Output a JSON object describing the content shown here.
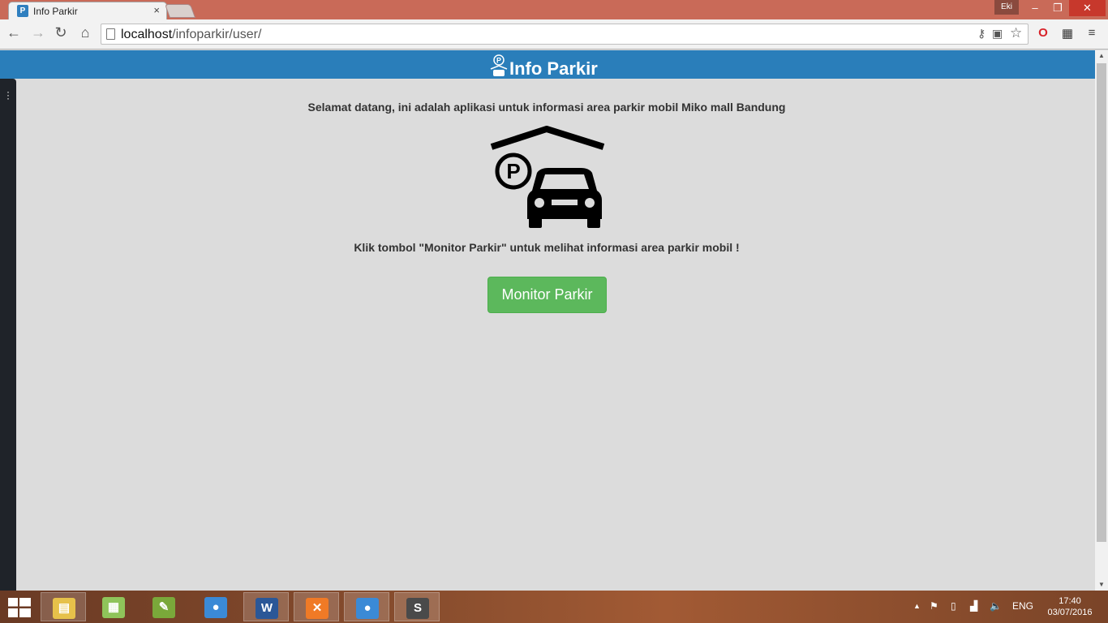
{
  "browser": {
    "tab_title": "Info Parkir",
    "tab_close_glyph": "×",
    "user_badge": "Eki",
    "window_controls": {
      "minimize": "–",
      "maximize": "❐",
      "close": "✕"
    },
    "url_host": "localhost",
    "url_path": "/infoparkir/user/"
  },
  "header": {
    "brand_icon_letter": "P",
    "title": "Info Parkir",
    "background_color": "#2a7eba"
  },
  "main": {
    "welcome_text": "Selamat datang, ini adalah aplikasi untuk informasi area parkir mobil Miko mall Bandung",
    "logo_letter": "P",
    "instruction_text": "Klik tombol \"Monitor Parkir\" untuk melihat informasi area parkir mobil !",
    "monitor_button_label": "Monitor Parkir",
    "button_color": "#5cb85c"
  },
  "taskbar": {
    "apps": [
      {
        "name": "file-explorer-icon",
        "glyph": "▤",
        "color": "#e6c14a"
      },
      {
        "name": "sticky-notes-icon",
        "glyph": "▦",
        "color": "#8fc45a"
      },
      {
        "name": "notepad-plus-icon",
        "glyph": "✎",
        "color": "#7aa83a"
      },
      {
        "name": "chrome-icon",
        "glyph": "●",
        "color": "#3b8ad6"
      },
      {
        "name": "word-icon",
        "glyph": "W",
        "color": "#2b5797"
      },
      {
        "name": "xampp-icon",
        "glyph": "✕",
        "color": "#f07a26"
      },
      {
        "name": "chrome-active-icon",
        "glyph": "●",
        "color": "#3b8ad6"
      },
      {
        "name": "sublime-text-icon",
        "glyph": "S",
        "color": "#4a4a4a"
      }
    ],
    "language": "ENG",
    "time": "17:40",
    "date": "03/07/2016"
  }
}
